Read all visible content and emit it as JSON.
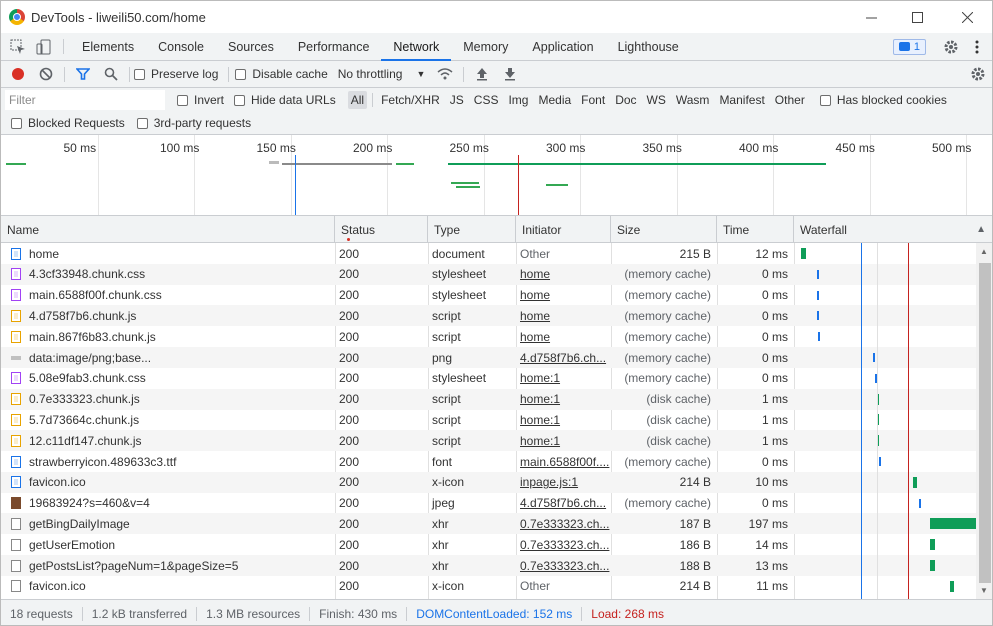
{
  "window": {
    "title": "DevTools - liweili50.com/home"
  },
  "tabs": [
    "Elements",
    "Console",
    "Sources",
    "Performance",
    "Network",
    "Memory",
    "Application",
    "Lighthouse"
  ],
  "active_tab": "Network",
  "issues_count": "1",
  "toolbar": {
    "preserve_log": "Preserve log",
    "disable_cache": "Disable cache",
    "throttling": "No throttling"
  },
  "filter": {
    "placeholder": "Filter",
    "invert": "Invert",
    "hide_data_urls": "Hide data URLs",
    "types": [
      "All",
      "Fetch/XHR",
      "JS",
      "CSS",
      "Img",
      "Media",
      "Font",
      "Doc",
      "WS",
      "Wasm",
      "Manifest",
      "Other"
    ],
    "has_blocked_cookies": "Has blocked cookies",
    "blocked_requests": "Blocked Requests",
    "third_party": "3rd-party requests"
  },
  "overview": {
    "ticks": [
      "50 ms",
      "100 ms",
      "150 ms",
      "200 ms",
      "250 ms",
      "300 ms",
      "350 ms",
      "400 ms",
      "450 ms",
      "500 ms"
    ]
  },
  "columns": [
    "Name",
    "Status",
    "Type",
    "Initiator",
    "Size",
    "Time",
    "Waterfall"
  ],
  "rows": [
    {
      "name": "home",
      "status": "200",
      "type": "document",
      "initiator": "Other",
      "initiator_link": false,
      "size": "215 B",
      "size_gray": false,
      "time": "12 ms",
      "icon": "document-icon",
      "start": 0,
      "dur": 12
    },
    {
      "name": "4.3cf33948.chunk.css",
      "status": "200",
      "type": "stylesheet",
      "initiator": "home",
      "initiator_link": true,
      "size": "(memory cache)",
      "size_gray": true,
      "time": "0 ms",
      "icon": "stylesheet-icon",
      "start": 18,
      "dur": 0
    },
    {
      "name": "main.6588f00f.chunk.css",
      "status": "200",
      "type": "stylesheet",
      "initiator": "home",
      "initiator_link": true,
      "size": "(memory cache)",
      "size_gray": true,
      "time": "0 ms",
      "icon": "stylesheet-icon",
      "start": 18,
      "dur": 0
    },
    {
      "name": "4.d758f7b6.chunk.js",
      "status": "200",
      "type": "script",
      "initiator": "home",
      "initiator_link": true,
      "size": "(memory cache)",
      "size_gray": true,
      "time": "0 ms",
      "icon": "script-icon",
      "start": 18,
      "dur": 0
    },
    {
      "name": "main.867f6b83.chunk.js",
      "status": "200",
      "type": "script",
      "initiator": "home",
      "initiator_link": true,
      "size": "(memory cache)",
      "size_gray": true,
      "time": "0 ms",
      "icon": "script-icon",
      "start": 19,
      "dur": 0
    },
    {
      "name": "data:image/png;base...",
      "status": "200",
      "type": "png",
      "initiator": "4.d758f7b6.ch...",
      "initiator_link": true,
      "size": "(memory cache)",
      "size_gray": true,
      "time": "0 ms",
      "icon": "data-url-icon",
      "start": 82,
      "dur": 0
    },
    {
      "name": "5.08e9fab3.chunk.css",
      "status": "200",
      "type": "stylesheet",
      "initiator": "home:1",
      "initiator_link": true,
      "size": "(memory cache)",
      "size_gray": true,
      "time": "0 ms",
      "icon": "stylesheet-icon",
      "start": 85,
      "dur": 0
    },
    {
      "name": "0.7e333323.chunk.js",
      "status": "200",
      "type": "script",
      "initiator": "home:1",
      "initiator_link": true,
      "size": "(disk cache)",
      "size_gray": true,
      "time": "1 ms",
      "icon": "script-icon",
      "start": 87,
      "dur": 1
    },
    {
      "name": "5.7d73664c.chunk.js",
      "status": "200",
      "type": "script",
      "initiator": "home:1",
      "initiator_link": true,
      "size": "(disk cache)",
      "size_gray": true,
      "time": "1 ms",
      "icon": "script-icon",
      "start": 87,
      "dur": 1
    },
    {
      "name": "12.c11df147.chunk.js",
      "status": "200",
      "type": "script",
      "initiator": "home:1",
      "initiator_link": true,
      "size": "(disk cache)",
      "size_gray": true,
      "time": "1 ms",
      "icon": "script-icon",
      "start": 87,
      "dur": 1
    },
    {
      "name": "strawberryicon.489633c3.ttf",
      "status": "200",
      "type": "font",
      "initiator": "main.6588f00f....",
      "initiator_link": true,
      "size": "(memory cache)",
      "size_gray": true,
      "time": "0 ms",
      "icon": "font-icon",
      "start": 89,
      "dur": 0
    },
    {
      "name": "favicon.ico",
      "status": "200",
      "type": "x-icon",
      "initiator": "inpage.js:1",
      "initiator_link": true,
      "size": "214 B",
      "size_gray": false,
      "time": "10 ms",
      "icon": "image-icon",
      "start": 128,
      "dur": 10
    },
    {
      "name": "19683924?s=460&v=4",
      "status": "200",
      "type": "jpeg",
      "initiator": "4.d758f7b6.ch...",
      "initiator_link": true,
      "size": "(memory cache)",
      "size_gray": true,
      "time": "0 ms",
      "icon": "avatar-image-icon",
      "start": 135,
      "dur": 0
    },
    {
      "name": "getBingDailyImage",
      "status": "200",
      "type": "xhr",
      "initiator": "0.7e333323.ch...",
      "initiator_link": true,
      "size": "187 B",
      "size_gray": false,
      "time": "197 ms",
      "icon": "xhr-icon",
      "start": 147,
      "dur": 197
    },
    {
      "name": "getUserEmotion",
      "status": "200",
      "type": "xhr",
      "initiator": "0.7e333323.ch...",
      "initiator_link": true,
      "size": "186 B",
      "size_gray": false,
      "time": "14 ms",
      "icon": "xhr-icon",
      "start": 147,
      "dur": 14
    },
    {
      "name": "getPostsList?pageNum=1&pageSize=5",
      "status": "200",
      "type": "xhr",
      "initiator": "0.7e333323.ch...",
      "initiator_link": true,
      "size": "188 B",
      "size_gray": false,
      "time": "13 ms",
      "icon": "xhr-icon",
      "start": 147,
      "dur": 13
    },
    {
      "name": "favicon.ico",
      "status": "200",
      "type": "x-icon",
      "initiator": "Other",
      "initiator_link": false,
      "size": "214 B",
      "size_gray": false,
      "time": "11 ms",
      "icon": "file-icon",
      "start": 170,
      "dur": 11
    }
  ],
  "status_bar": {
    "requests": "18 requests",
    "transferred": "1.2 kB transferred",
    "resources": "1.3 MB resources",
    "finish": "Finish: 430 ms",
    "dom_content_loaded": "DOMContentLoaded: 152 ms",
    "load": "Load: 268 ms"
  },
  "colors": {
    "accent": "#1a73e8",
    "record": "#d93025",
    "dcl": "#1a73e8",
    "load": "#c5221f",
    "bar": "#0f9d58"
  }
}
